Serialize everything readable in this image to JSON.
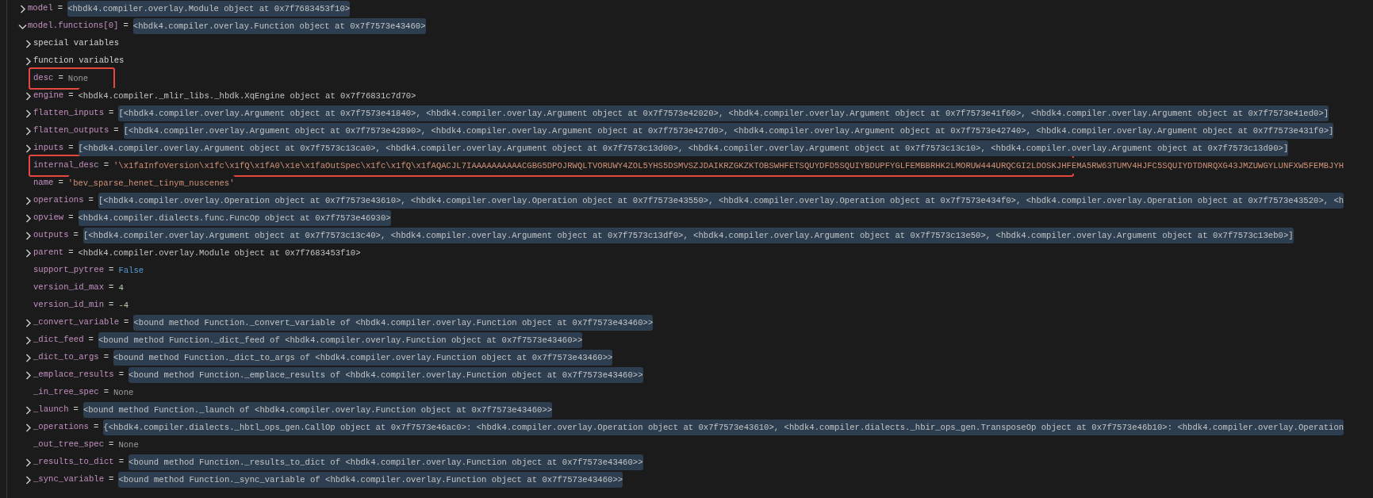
{
  "variables": [
    {
      "name": "model",
      "separator": "=",
      "value": "<hbdk4.compiler.overlay.Module object at 0x7f7683453f10>",
      "kind": "object",
      "expandable": true,
      "expanded": false,
      "highlighted": true,
      "outlined": false
    },
    {
      "name": "model.functions[0]",
      "separator": "=",
      "value": "<hbdk4.compiler.overlay.Function object at 0x7f7573e43460>",
      "kind": "object",
      "expandable": true,
      "expanded": true,
      "highlighted": true,
      "outlined": false,
      "children": [
        {
          "name": "special variables",
          "kind": "group",
          "expandable": true,
          "expanded": false,
          "outlined": false
        },
        {
          "name": "function variables",
          "kind": "group",
          "expandable": true,
          "expanded": false,
          "outlined": false
        },
        {
          "name": "desc",
          "separator": "=",
          "value": "None",
          "kind": "none",
          "expandable": false,
          "highlighted": false,
          "outlined": true
        },
        {
          "name": "engine",
          "separator": "=",
          "value": "<hbdk4.compiler._mlir_libs._hbdk.XqEngine object at 0x7f76831c7d70>",
          "kind": "object",
          "expandable": true,
          "expanded": false,
          "highlighted": false,
          "outlined": false
        },
        {
          "name": "flatten_inputs",
          "separator": "=",
          "value": "[<hbdk4.compiler.overlay.Argument object at 0x7f7573e41840>, <hbdk4.compiler.overlay.Argument object at 0x7f7573e42020>, <hbdk4.compiler.overlay.Argument object at 0x7f7573e41f60>, <hbdk4.compiler.overlay.Argument object at 0x7f7573e41ed0>]",
          "kind": "object",
          "expandable": true,
          "expanded": false,
          "highlighted": true,
          "outlined": false
        },
        {
          "name": "flatten_outputs",
          "separator": "=",
          "value": "[<hbdk4.compiler.overlay.Argument object at 0x7f7573e42890>, <hbdk4.compiler.overlay.Argument object at 0x7f7573e427d0>, <hbdk4.compiler.overlay.Argument object at 0x7f7573e42740>, <hbdk4.compiler.overlay.Argument object at 0x7f7573e431f0>]",
          "kind": "object",
          "expandable": true,
          "expanded": false,
          "highlighted": true,
          "outlined": false
        },
        {
          "name": "inputs",
          "separator": "=",
          "value": "[<hbdk4.compiler.overlay.Argument object at 0x7f7573c13ca0>, <hbdk4.compiler.overlay.Argument object at 0x7f7573c13d00>, <hbdk4.compiler.overlay.Argument object at 0x7f7573c13c10>, <hbdk4.compiler.overlay.Argument object at 0x7f7573c13d90>]",
          "kind": "object",
          "expandable": true,
          "expanded": false,
          "highlighted": true,
          "outlined": false
        },
        {
          "name": "internal_desc",
          "separator": "=",
          "value": "'\\x1faInfoVersion\\x1fc\\x1fQ\\x1fA0\\x1e\\x1faOutSpec\\x1fc\\x1fQ\\x1fAQACJL7IAAAAAAAAAACGBG5DPOJRWQLTVORUWY4ZOL5YHS5DSMVSZJDAIKRZGKZKTOBSWHFETSQUYDFD5SQUIYBDUPFYGLFEMBBRHK2LMORUW444URQCGI2LDOSKJHFEMA5RW63TUMV4HJFC5SQUIYDTDNRQXG43JMZUWGYLUNFXW5FEMBJYH",
          "kind": "string",
          "expandable": false,
          "highlighted": false,
          "outlined": true
        },
        {
          "name": "name",
          "separator": "=",
          "value": "'bev_sparse_henet_tinym_nuscenes'",
          "kind": "string",
          "expandable": false,
          "highlighted": false,
          "outlined": false
        },
        {
          "name": "operations",
          "separator": "=",
          "value": "[<hbdk4.compiler.overlay.Operation object at 0x7f7573e43610>, <hbdk4.compiler.overlay.Operation object at 0x7f7573e43550>, <hbdk4.compiler.overlay.Operation object at 0x7f7573e434f0>, <hbdk4.compiler.overlay.Operation object at 0x7f7573e43520>, <h",
          "kind": "object",
          "expandable": true,
          "expanded": false,
          "highlighted": true,
          "outlined": false
        },
        {
          "name": "opview",
          "separator": "=",
          "value": "<hbdk4.compiler.dialects.func.FuncOp object at 0x7f7573e46930>",
          "kind": "object",
          "expandable": true,
          "expanded": false,
          "highlighted": true,
          "outlined": false
        },
        {
          "name": "outputs",
          "separator": "=",
          "value": "[<hbdk4.compiler.overlay.Argument object at 0x7f7573c13c40>, <hbdk4.compiler.overlay.Argument object at 0x7f7573c13df0>, <hbdk4.compiler.overlay.Argument object at 0x7f7573c13e50>, <hbdk4.compiler.overlay.Argument object at 0x7f7573c13eb0>]",
          "kind": "object",
          "expandable": true,
          "expanded": false,
          "highlighted": true,
          "outlined": false
        },
        {
          "name": "parent",
          "separator": "=",
          "value": "<hbdk4.compiler.overlay.Module object at 0x7f7683453f10>",
          "kind": "object",
          "expandable": true,
          "expanded": false,
          "highlighted": false,
          "outlined": false
        },
        {
          "name": "support_pytree",
          "separator": "=",
          "value": "False",
          "kind": "bool",
          "expandable": false,
          "highlighted": false,
          "outlined": false
        },
        {
          "name": "version_id_max",
          "separator": "=",
          "value": "4",
          "kind": "number",
          "expandable": false,
          "highlighted": false,
          "outlined": false
        },
        {
          "name": "version_id_min",
          "separator": "=",
          "value": "-4",
          "kind": "number",
          "expandable": false,
          "highlighted": false,
          "outlined": false
        },
        {
          "name": "_convert_variable",
          "separator": "=",
          "value": "<bound method Function._convert_variable of <hbdk4.compiler.overlay.Function object at 0x7f7573e43460>>",
          "kind": "object",
          "expandable": true,
          "expanded": false,
          "highlighted": true,
          "outlined": false
        },
        {
          "name": "_dict_feed",
          "separator": "=",
          "value": "<bound method Function._dict_feed of <hbdk4.compiler.overlay.Function object at 0x7f7573e43460>>",
          "kind": "object",
          "expandable": true,
          "expanded": false,
          "highlighted": true,
          "outlined": false
        },
        {
          "name": "_dict_to_args",
          "separator": "=",
          "value": "<bound method Function._dict_to_args of <hbdk4.compiler.overlay.Function object at 0x7f7573e43460>>",
          "kind": "object",
          "expandable": true,
          "expanded": false,
          "highlighted": true,
          "outlined": false
        },
        {
          "name": "_emplace_results",
          "separator": "=",
          "value": "<bound method Function._emplace_results of <hbdk4.compiler.overlay.Function object at 0x7f7573e43460>>",
          "kind": "object",
          "expandable": true,
          "expanded": false,
          "highlighted": true,
          "outlined": false
        },
        {
          "name": "_in_tree_spec",
          "separator": "=",
          "value": "None",
          "kind": "none",
          "expandable": false,
          "highlighted": false,
          "outlined": false
        },
        {
          "name": "_launch",
          "separator": "=",
          "value": "<bound method Function._launch of <hbdk4.compiler.overlay.Function object at 0x7f7573e43460>>",
          "kind": "object",
          "expandable": true,
          "expanded": false,
          "highlighted": true,
          "outlined": false
        },
        {
          "name": "_operations",
          "separator": "=",
          "value": "{<hbdk4.compiler.dialects._hbtl_ops_gen.CallOp object at 0x7f7573e46ac0>: <hbdk4.compiler.overlay.Operation object at 0x7f7573e43610>, <hbdk4.compiler.dialects._hbir_ops_gen.TransposeOp object at 0x7f7573e46b10>: <hbdk4.compiler.overlay.Operation",
          "kind": "object",
          "expandable": true,
          "expanded": false,
          "highlighted": true,
          "outlined": false
        },
        {
          "name": "_out_tree_spec",
          "separator": "=",
          "value": "None",
          "kind": "none",
          "expandable": false,
          "highlighted": false,
          "outlined": false
        },
        {
          "name": "_results_to_dict",
          "separator": "=",
          "value": "<bound method Function._results_to_dict of <hbdk4.compiler.overlay.Function object at 0x7f7573e43460>>",
          "kind": "object",
          "expandable": true,
          "expanded": false,
          "highlighted": true,
          "outlined": false
        },
        {
          "name": "_sync_variable",
          "separator": "=",
          "value": "<bound method Function._sync_variable of <hbdk4.compiler.overlay.Function object at 0x7f7573e43460>>",
          "kind": "object",
          "expandable": true,
          "expanded": false,
          "highlighted": true,
          "outlined": false
        }
      ]
    }
  ]
}
